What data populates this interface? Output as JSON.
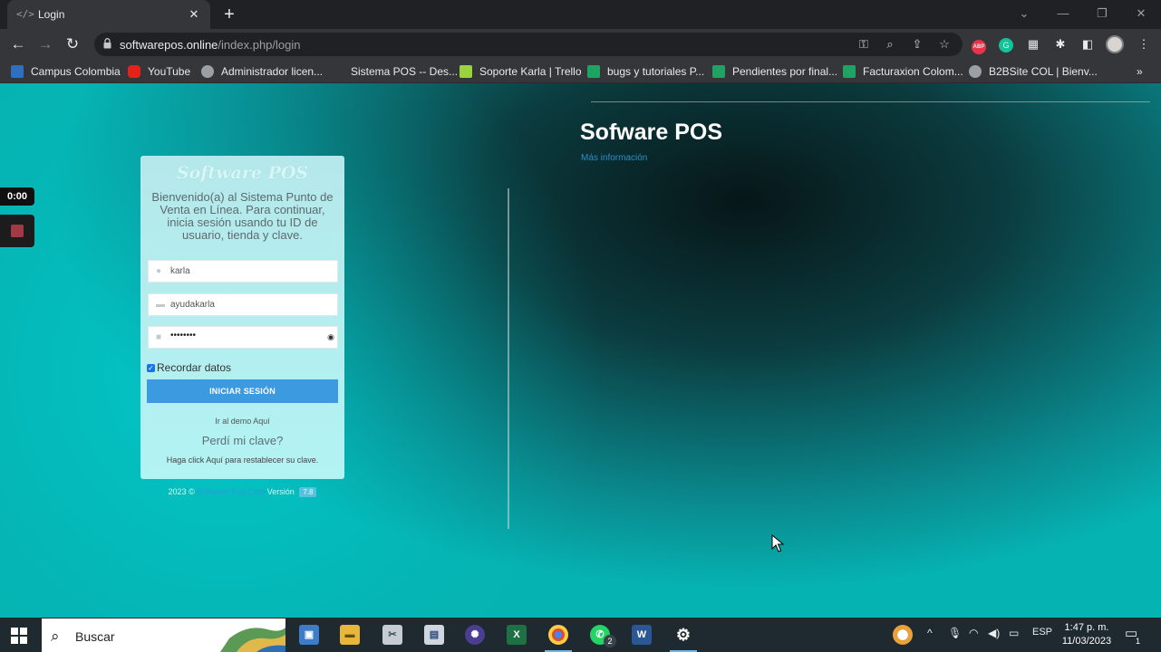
{
  "browser": {
    "tab_title": "Login",
    "tab_favicon": "</>",
    "url_host": "softwarepos.online",
    "url_path": "/index.php/login",
    "bookmarks": [
      {
        "label": "Campus Colombia",
        "color": "#2f6fbf"
      },
      {
        "label": "YouTube",
        "color": "#e62117"
      },
      {
        "label": "Administrador licen...",
        "color": "#9aa0a6"
      },
      {
        "label": "Sistema POS -- Des...",
        "color": "#35363a"
      },
      {
        "label": "Soporte Karla | Trello",
        "color": "#9bd33f"
      },
      {
        "label": "bugs y tutoriales P...",
        "color": "#1ea362"
      },
      {
        "label": "Pendientes por final...",
        "color": "#1ea362"
      },
      {
        "label": "Facturaxion Colom...",
        "color": "#1ea362"
      },
      {
        "label": "B2BSite COL | Bienv...",
        "color": "#9aa0a6"
      }
    ],
    "more_bookmarks": "»"
  },
  "recorder": {
    "time": "0:00"
  },
  "login": {
    "logo_text": "Software POS",
    "welcome": "Bienvenido(a) al Sistema Punto de Venta en Línea. Para continuar, inicia sesión usando tu ID de usuario, tienda y clave.",
    "user_value": "karla",
    "store_value": "ayudakarla",
    "password_value": "••••••••",
    "remember_label": "Recordar datos",
    "login_button": "INICIAR SESIÓN",
    "demo_link": "Ir al demo Aquí",
    "forgot_link": "Perdí mi clave?",
    "reset_text": "Haga click Aquí para restablecer su clave."
  },
  "footer": {
    "year": "2023 ©",
    "brand": "Software Pos.Com",
    "version_label": "Versión",
    "version": "7.8"
  },
  "hero": {
    "title": "Sofware POS",
    "more_info": "Más información"
  },
  "taskbar": {
    "search_placeholder": "Buscar",
    "language": "ESP",
    "time": "1:47 p. m.",
    "date": "11/03/2023",
    "whatsapp_badge": "2",
    "notifications_badge": "1"
  },
  "colors": {
    "accent": "#3b9ae0",
    "card_bg": "#b2f3f3",
    "page_teal": "#0aa3a4"
  }
}
